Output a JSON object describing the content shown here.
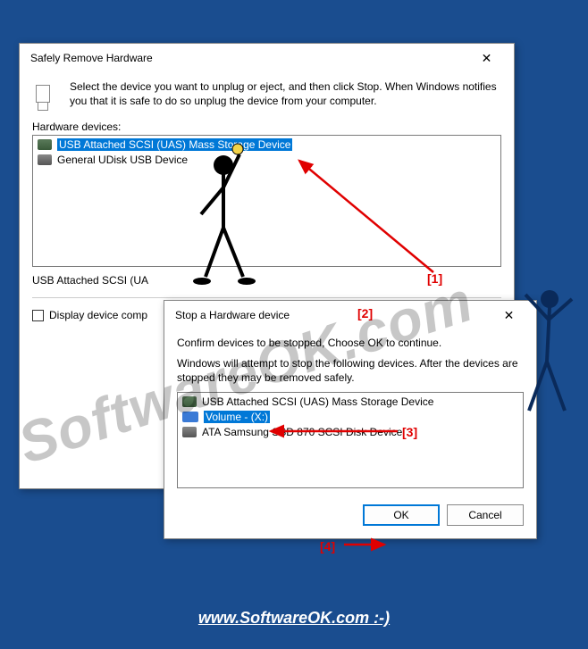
{
  "dialog1": {
    "title": "Safely Remove Hardware",
    "instruction": "Select the device you want to unplug or eject, and then click Stop. When Windows notifies you that it is safe to do so unplug the device from your computer.",
    "section_label": "Hardware devices:",
    "devices": [
      "USB Attached SCSI (UAS) Mass Storage Device",
      "General UDisk USB Device"
    ],
    "status": "USB Attached SCSI (UA",
    "checkbox_label": "Display device comp"
  },
  "dialog2": {
    "title": "Stop a Hardware device",
    "line1": "Confirm devices to be stopped, Choose OK to continue.",
    "line2": "Windows will attempt to stop the following devices. After the devices are stopped they may be removed safely.",
    "devices": [
      "USB Attached SCSI (UAS) Mass Storage Device",
      "Volume - (X:)",
      "ATA Samsung SSD 870 SCSI Disk Device"
    ],
    "ok_label": "OK",
    "cancel_label": "Cancel"
  },
  "annotations": {
    "a1": "[1]",
    "a2": "[2]",
    "a3": "[3]",
    "a4": "[4]"
  },
  "watermark": "SoftwareOK.com",
  "footer": "www.SoftwareOK.com :-)"
}
